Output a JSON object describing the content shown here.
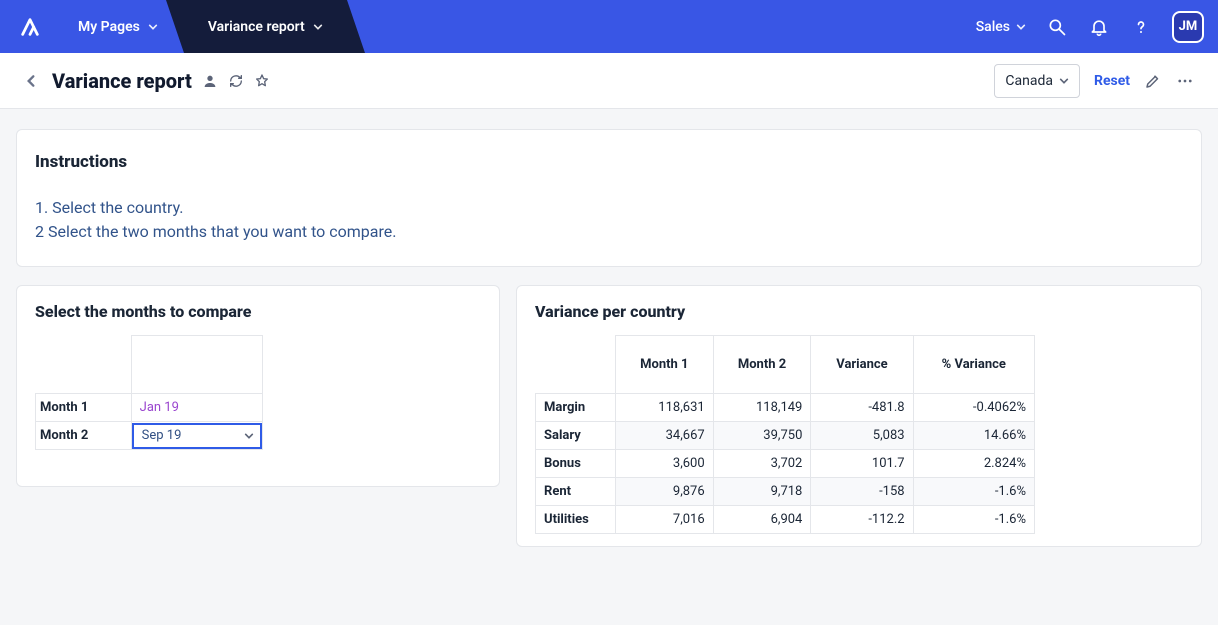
{
  "header": {
    "my_pages_label": "My Pages",
    "active_tab_label": "Variance report",
    "sales_label": "Sales",
    "avatar_initials": "JM"
  },
  "subheader": {
    "title": "Variance report",
    "country_label": "Canada",
    "reset_label": "Reset"
  },
  "instructions": {
    "title": "Instructions",
    "line1": "1. Select the country.",
    "line2": "2 Select the two months that you want to compare."
  },
  "compare": {
    "title": "Select the months to compare",
    "month1_label": "Month 1",
    "month2_label": "Month 2",
    "month1_value": "Jan 19",
    "month2_value": "Sep 19"
  },
  "variance": {
    "title": "Variance per country",
    "columns": {
      "month1": "Month 1",
      "month2": "Month 2",
      "variance": "Variance",
      "pct_variance": "% Variance"
    },
    "rows": [
      {
        "label": "Margin",
        "m1": "118,631",
        "m2": "118,149",
        "var": "-481.8",
        "pct": "-0.4062%"
      },
      {
        "label": "Salary",
        "m1": "34,667",
        "m2": "39,750",
        "var": "5,083",
        "pct": "14.66%"
      },
      {
        "label": "Bonus",
        "m1": "3,600",
        "m2": "3,702",
        "var": "101.7",
        "pct": "2.824%"
      },
      {
        "label": "Rent",
        "m1": "9,876",
        "m2": "9,718",
        "var": "-158",
        "pct": "-1.6%"
      },
      {
        "label": "Utilities",
        "m1": "7,016",
        "m2": "6,904",
        "var": "-112.2",
        "pct": "-1.6%"
      }
    ]
  }
}
